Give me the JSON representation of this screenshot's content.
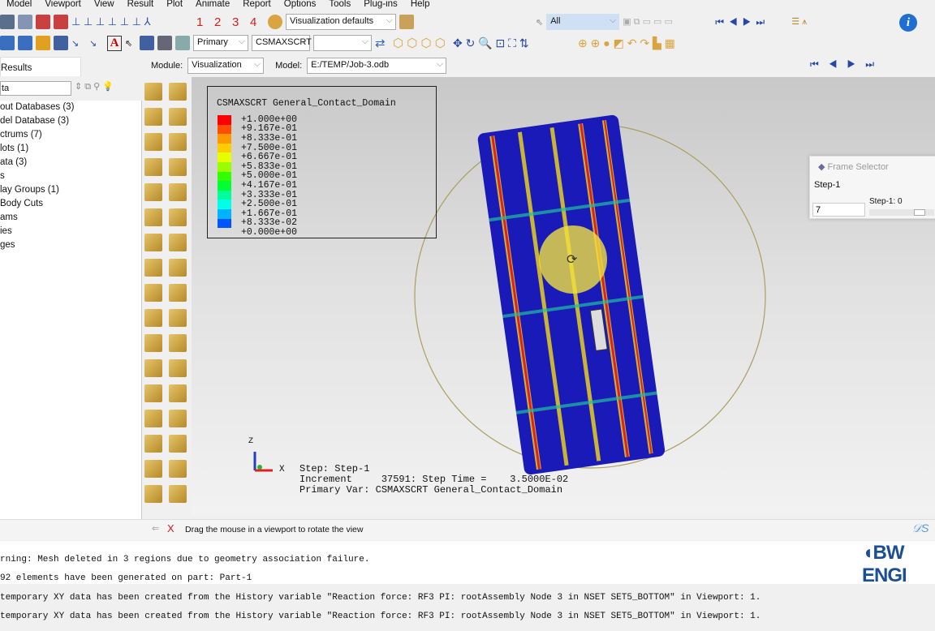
{
  "menu": [
    "Model",
    "Viewport",
    "View",
    "Result",
    "Plot",
    "Animate",
    "Report",
    "Options",
    "Tools",
    "Plug-ins",
    "Help"
  ],
  "toolbar": {
    "views": [
      "1",
      "2",
      "3",
      "4"
    ],
    "render_style": "Visualization defaults",
    "selection_filter": "All",
    "field_output_position": "Primary",
    "field_variable": "CSMAXSCRT",
    "field_component": ""
  },
  "context": {
    "module_label": "Module:",
    "module": "Visualization",
    "model_label": "Model:",
    "model": "E:/TEMP/Job-3.odb"
  },
  "left_panel": {
    "tab": "Results",
    "filter": "ta",
    "items": [
      "out Databases (3)",
      "del Database (3)",
      "ctrums (7)",
      "lots (1)",
      "ata (3)",
      "s",
      "lay Groups (1)",
      " Body Cuts",
      "ams",
      "ies",
      "ges"
    ]
  },
  "legend": {
    "title": "CSMAXSCRT General_Contact_Domain",
    "entries": [
      {
        "label": "+1.000e+00",
        "color": "#ff0000"
      },
      {
        "label": "+9.167e-01",
        "color": "#ff4d00"
      },
      {
        "label": "+8.333e-01",
        "color": "#ff9900"
      },
      {
        "label": "+7.500e-01",
        "color": "#ffcc00"
      },
      {
        "label": "+6.667e-01",
        "color": "#e6ff00"
      },
      {
        "label": "+5.833e-01",
        "color": "#99ff00"
      },
      {
        "label": "+5.000e-01",
        "color": "#33ff00"
      },
      {
        "label": "+4.167e-01",
        "color": "#00ff33"
      },
      {
        "label": "+3.333e-01",
        "color": "#00ff99"
      },
      {
        "label": "+2.500e-01",
        "color": "#00ffe6"
      },
      {
        "label": "+1.667e-01",
        "color": "#00b3ff"
      },
      {
        "label": "+8.333e-02",
        "color": "#0055ff"
      },
      {
        "label": "+0.000e+00",
        "color": ""
      }
    ]
  },
  "triad": {
    "z": "Z",
    "x": "X"
  },
  "state": {
    "step": "Step: Step-1",
    "increment": "Increment     37591: Step Time =    3.5000E-02",
    "primary": "Primary Var: CSMAXSCRT General_Contact_Domain"
  },
  "frame_selector": {
    "title": "Frame Selector",
    "step": "Step-1",
    "frame_value": "7",
    "slider_label": "Step-1: 0"
  },
  "prompt": {
    "text": "Drag the mouse in a viewport to rotate the view"
  },
  "messages": [
    "rning: Mesh deleted in 3 regions due to geometry association failure.",
    "92 elements have been generated on part: Part-1",
    "temporary XY data has been created from the History variable \"Reaction force: RF3 PI: rootAssembly Node 3 in NSET SET5_BOTTOM\" in Viewport: 1.",
    "temporary XY data has been created from the History variable \"Reaction force: RF3 PI: rootAssembly Node 3 in NSET SET5_BOTTOM\" in Viewport: 1."
  ],
  "watermark": "BW ENGI"
}
